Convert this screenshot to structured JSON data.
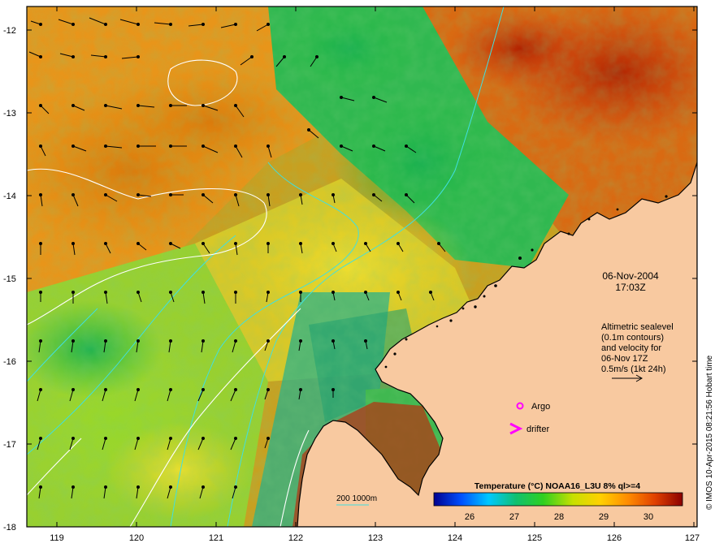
{
  "map": {
    "date": "06-Nov-2004",
    "time": "17:03Z",
    "altimetry_lines": [
      "Altimetric sealevel",
      "(0.1m contours)",
      "and velocity for",
      "06-Nov 17Z",
      "0.5m/s (1kt 24h)"
    ],
    "argo_label": "Argo",
    "drifter_label": "drifter",
    "isobath_label": "200  1000m",
    "credit": "© IMOS 10-Apr-2015 08:21:56 Hobart time",
    "colorbar": {
      "title": "Temperature (°C) NOAA16_L3U 8% ql>=4",
      "ticks": [
        "26",
        "27",
        "28",
        "29",
        "30"
      ],
      "tick_values": [
        26,
        27,
        28,
        29,
        30
      ],
      "range": [
        24.7,
        30.9
      ],
      "colors": [
        "#00008f",
        "#0050ff",
        "#00c8ff",
        "#10c070",
        "#30d020",
        "#c8e000",
        "#ffd000",
        "#ff8c00",
        "#e04000",
        "#8b0000"
      ]
    },
    "lon_ticks": [
      "119",
      "120",
      "121",
      "122",
      "123",
      "124",
      "125",
      "126",
      "127"
    ],
    "lon_values": [
      119,
      120,
      121,
      122,
      123,
      124,
      125,
      126,
      127
    ],
    "lat_ticks": [
      "-12",
      "-13",
      "-14",
      "-15",
      "-16",
      "-17",
      "-18"
    ],
    "lat_values": [
      -12,
      -13,
      -14,
      -15,
      -16,
      -17,
      -18
    ],
    "extent": {
      "lon_min": 118.6,
      "lon_max": 127,
      "lat_min": -18,
      "lat_max": -11.8
    },
    "colors": {
      "land": "#f8c9a0",
      "frame": "#000000",
      "argo": "#ff00ff",
      "drifter": "#ff00ff",
      "isobath": "#40e0e0",
      "sealevel_contour": "#ffffff",
      "vector": "#000000"
    }
  }
}
